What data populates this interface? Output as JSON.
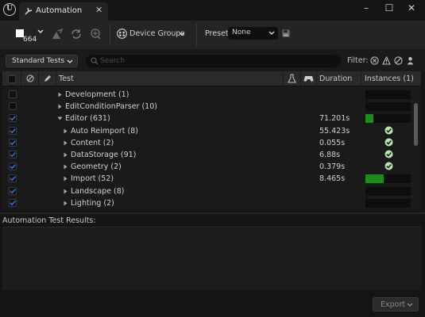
{
  "window": {
    "tab_title": "Automation",
    "logo_icon": "unreal-logo-icon",
    "controls": [
      "minimize-icon",
      "maximize-icon",
      "close-icon"
    ]
  },
  "toolbar": {
    "run_count": "664",
    "device_groups_label": "Device Groups",
    "preset_label": "Preset:",
    "preset_value": "None"
  },
  "filterbar": {
    "tests_dropdown": "Standard Tests",
    "search_placeholder": "Search",
    "filter_label": "Filter:"
  },
  "table": {
    "columns": {
      "test": "Test",
      "duration": "Duration",
      "instances": "Instances (1)"
    },
    "rows": [
      {
        "name": "Development (1)",
        "checked": false,
        "duration": "",
        "expanded": false,
        "level": 0,
        "instance_progress": 0,
        "status": "none"
      },
      {
        "name": "EditConditionParser (10)",
        "checked": false,
        "duration": "",
        "expanded": false,
        "level": 0,
        "instance_progress": 0,
        "status": "none"
      },
      {
        "name": "Editor (631)",
        "checked": true,
        "duration": "71.201s",
        "expanded": true,
        "level": 0,
        "instance_progress": 0.18,
        "status": "progress"
      },
      {
        "name": "Auto Reimport (8)",
        "checked": true,
        "duration": "55.423s",
        "expanded": false,
        "level": 1,
        "instance_progress": 1,
        "status": "passed"
      },
      {
        "name": "Content (2)",
        "checked": true,
        "duration": "0.055s",
        "expanded": false,
        "level": 1,
        "instance_progress": 1,
        "status": "passed"
      },
      {
        "name": "DataStorage (91)",
        "checked": true,
        "duration": "6.88s",
        "expanded": false,
        "level": 1,
        "instance_progress": 1,
        "status": "passed"
      },
      {
        "name": "Geometry (2)",
        "checked": true,
        "duration": "0.379s",
        "expanded": false,
        "level": 1,
        "instance_progress": 1,
        "status": "passed"
      },
      {
        "name": "Import (52)",
        "checked": true,
        "duration": "8.465s",
        "expanded": false,
        "level": 1,
        "instance_progress": 0.4,
        "status": "progress"
      },
      {
        "name": "Landscape (8)",
        "checked": true,
        "duration": "",
        "expanded": false,
        "level": 1,
        "instance_progress": 0,
        "status": "none"
      },
      {
        "name": "Lighting (2)",
        "checked": true,
        "duration": "",
        "expanded": false,
        "level": 1,
        "instance_progress": 0,
        "status": "none"
      }
    ]
  },
  "results": {
    "label": "Automation Test Results:"
  },
  "export_button": "Export",
  "colors": {
    "accent_blue": "#2f6fd6",
    "success_green": "#1f8a1f",
    "check_green": "#b9e6a8"
  }
}
